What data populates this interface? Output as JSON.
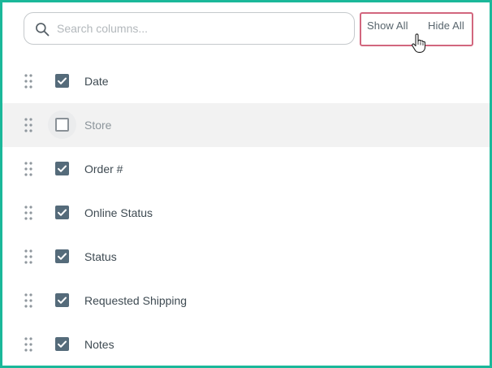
{
  "search": {
    "placeholder": "Search columns..."
  },
  "actions": {
    "show_all": "Show All",
    "hide_all": "Hide All"
  },
  "columns": [
    {
      "label": "Date",
      "checked": true
    },
    {
      "label": "Store",
      "checked": false
    },
    {
      "label": "Order #",
      "checked": true
    },
    {
      "label": "Online Status",
      "checked": true
    },
    {
      "label": "Status",
      "checked": true
    },
    {
      "label": "Requested Shipping",
      "checked": true
    },
    {
      "label": "Notes",
      "checked": true
    }
  ],
  "colors": {
    "frame_border": "#1bb89a",
    "highlight_box": "#d2667e",
    "checkbox_checked": "#556b7a",
    "hover_row": "#f2f2f2"
  },
  "icons": {
    "search": "search-icon",
    "drag": "drag-handle-icon",
    "check": "check-icon",
    "cursor": "hand-pointer-icon"
  }
}
